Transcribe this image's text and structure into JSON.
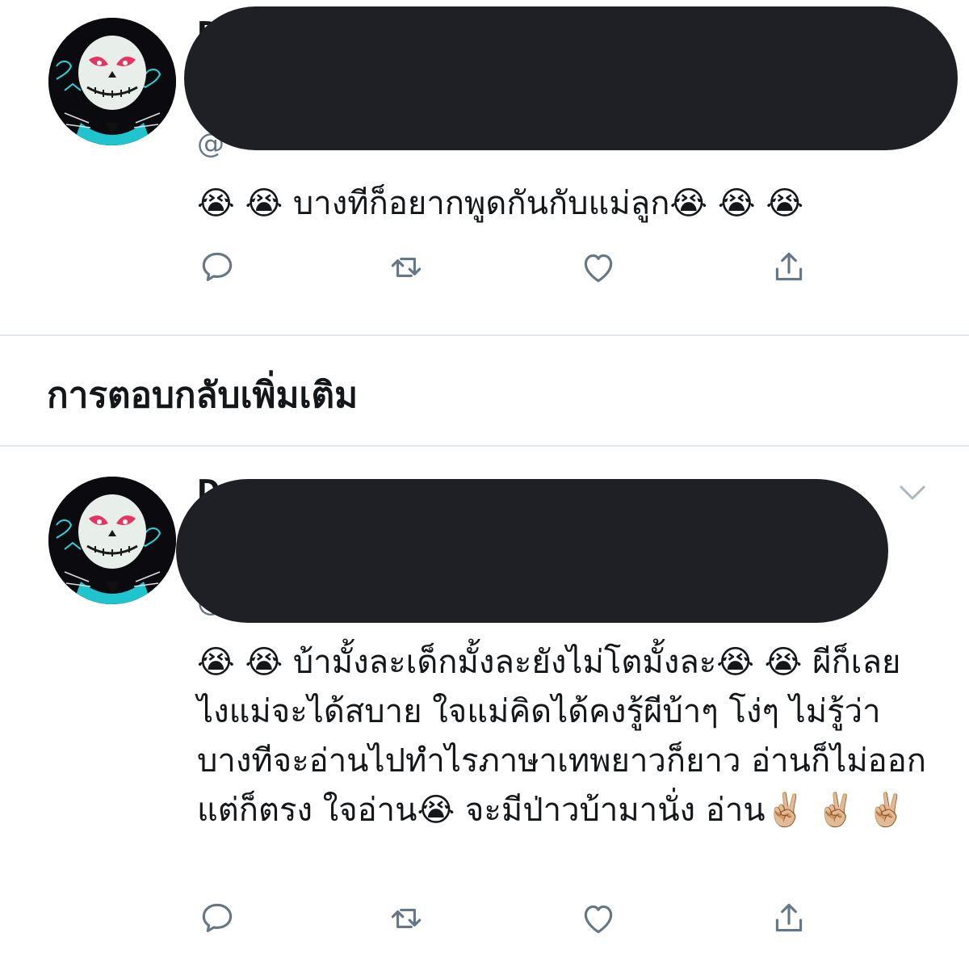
{
  "tweet1": {
    "name_peek": "D",
    "handle_peek": "@",
    "text": "😭 😭 บางทีก็อยากพูดกันกับแม่ลูก😭 😭 😭",
    "actions": [
      "reply-icon",
      "retweet-icon",
      "like-icon",
      "share-icon"
    ]
  },
  "section": {
    "title": "การตอบกลับเพิ่มเติม"
  },
  "tweet2": {
    "name_peek": "D",
    "handle_peek": "@",
    "text": "😭 😭 บ้ามั้งละเด็กมั้งละยังไม่โตมั้งละ😭 😭 ผีก็เลยไงแม่จะได้สบาย ใจแม่คิดได้คงรู้ผีบ้าๆ โง่ๆ ไม่รู้ว่าบางทีจะอ่านไปทำไรภาษาเทพยาวก็ยาว อ่านก็ไม่ออกแต่ก็ตรง ใจอ่าน😭 จะมีป่าวบ้ามานั่ง อ่าน✌🏼 ✌🏼 ✌🏼",
    "actions": [
      "reply-icon",
      "retweet-icon",
      "like-icon",
      "share-icon"
    ],
    "menu": "chevron-down-icon"
  },
  "colors": {
    "icon": "#657786",
    "redaction": "#1e2025",
    "divider": "#e1e8ed"
  }
}
